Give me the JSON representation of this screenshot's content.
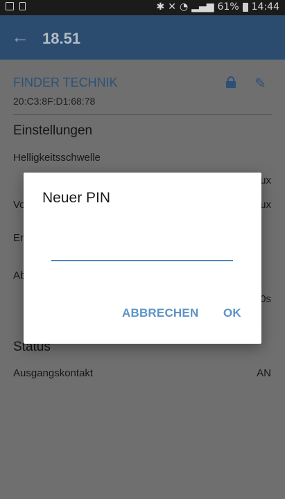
{
  "status_bar": {
    "battery": "61%",
    "time": "14:44"
  },
  "app_bar": {
    "title": "18.51"
  },
  "device": {
    "name": "FINDER TECHNIK",
    "mac": "20:C3:8F:D1:68:78"
  },
  "settings": {
    "heading": "Einstellungen",
    "rows": [
      {
        "label": "Helligkeitsschwelle",
        "value": ""
      },
      {
        "label": "",
        "value": "ux"
      },
      {
        "label": "Vo",
        "value": "ux"
      },
      {
        "label": "Er",
        "value": ""
      },
      {
        "label": "Ab",
        "value": ""
      },
      {
        "label": "",
        "value": "0s"
      }
    ]
  },
  "status": {
    "heading": "Status",
    "rows": [
      {
        "label": "Ausgangskontakt",
        "value": "AN"
      }
    ]
  },
  "dialog": {
    "title": "Neuer PIN",
    "input_value": "",
    "cancel_label": "ABBRECHEN",
    "ok_label": "OK"
  }
}
